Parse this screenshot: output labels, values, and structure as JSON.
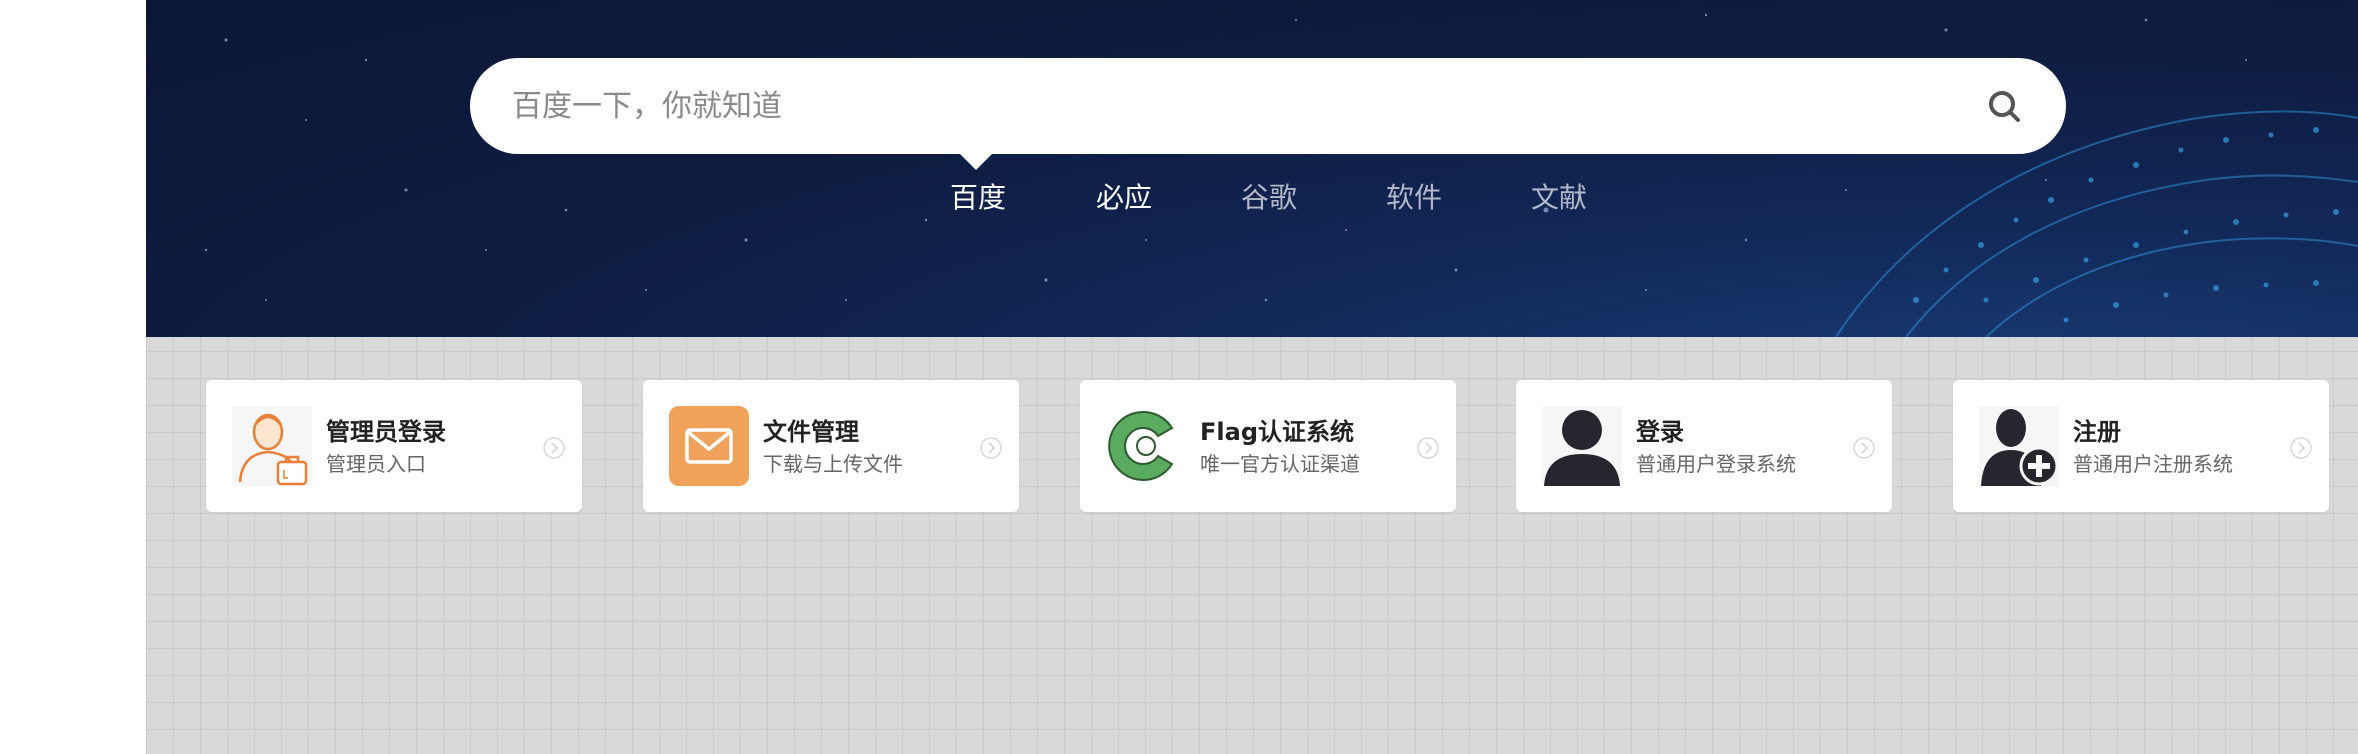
{
  "search": {
    "placeholder": "百度一下，你就知道"
  },
  "engines": [
    {
      "label": "百度",
      "active": true
    },
    {
      "label": "必应",
      "active": false
    },
    {
      "label": "谷歌",
      "active": false
    },
    {
      "label": "软件",
      "active": false
    },
    {
      "label": "文献",
      "active": false
    }
  ],
  "cards": [
    {
      "title": "管理员登录",
      "subtitle": "管理员入口",
      "icon": "admin-icon",
      "accent": "#e8803a"
    },
    {
      "title": "文件管理",
      "subtitle": "下载与上传文件",
      "icon": "mail-icon",
      "accent": "#f0a25a"
    },
    {
      "title": "Flag认证系统",
      "subtitle": "唯一官方认证渠道",
      "icon": "flag-c-icon",
      "accent": "#5aaa5f"
    },
    {
      "title": "登录",
      "subtitle": "普通用户登录系统",
      "icon": "user-icon",
      "accent": "#26262e"
    },
    {
      "title": "注册",
      "subtitle": "普通用户注册系统",
      "icon": "user-add-icon",
      "accent": "#26262e"
    }
  ],
  "colors": {
    "banner": "#0f1d42",
    "panel": "#d9d9d9",
    "card": "#ffffff"
  }
}
